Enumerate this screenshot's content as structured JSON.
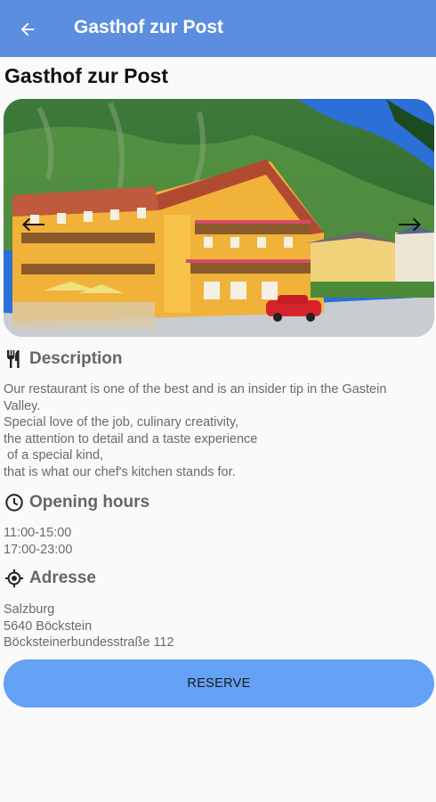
{
  "appbar": {
    "back_icon": "arrow-left-icon",
    "title": "Gasthof zur Post"
  },
  "page": {
    "title": "Gasthof zur Post"
  },
  "gallery": {
    "image_alt": "Gasthof zur Post building photo",
    "prev_icon": "arrow-left-icon",
    "next_icon": "arrow-right-icon"
  },
  "description": {
    "icon": "fork-knife-icon",
    "heading": "Description",
    "lines": [
      "Our restaurant is one of the best and is an insider tip in the Gastein",
      "Valley.",
      "Special love of the job, culinary creativity,",
      "the attention to detail and a taste experience",
      " of a special kind,",
      "that is what our chef's kitchen stands for."
    ]
  },
  "hours": {
    "icon": "clock-icon",
    "heading": "Opening hours",
    "lines": [
      "11:00-15:00",
      "17:00-23:00"
    ]
  },
  "address": {
    "icon": "location-target-icon",
    "heading": "Adresse",
    "lines": [
      "Salzburg",
      "5640 Böckstein",
      "Böcksteinerbundesstraße 112"
    ]
  },
  "actions": {
    "reserve_label": "RESERVE"
  },
  "colors": {
    "appbar": "#5b8ee0",
    "button": "#63a2f5",
    "background": "#fafafa"
  }
}
